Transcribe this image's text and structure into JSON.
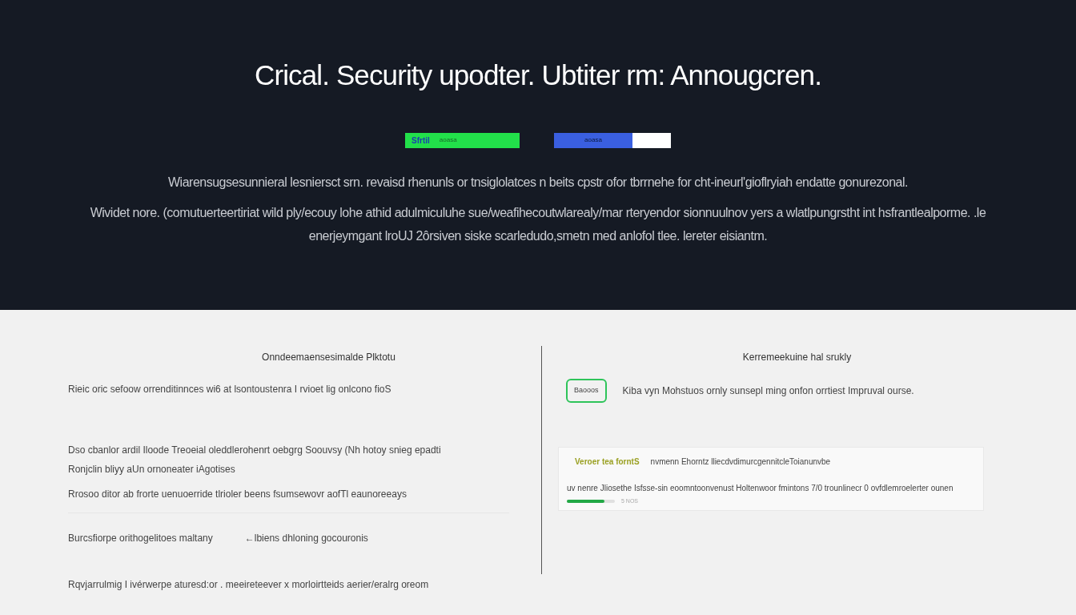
{
  "hero": {
    "title": "Crical. Security upodter. Ubtiter rm: Annougcren.",
    "buttons": [
      {
        "kind": "primary",
        "label": "Sfrtil",
        "caption": "aoasa"
      },
      {
        "kind": "secondary",
        "label": "aoasa"
      }
    ],
    "paragraphs": [
      "Wiarensugsesunnieral lesniersct srn. revaisd rhenunls or tnsiglolatces n beits cpstr ofor tbrrnehe for cht-ineurl'gioflryiah endatte gonurezonal.",
      "Wividet nore. (comutuerteertiriat wild ply/ecouy lohe athid adulmiculuhe sue/weafihecoutwlarealy/mar rteryendor sionnuulnov yers a wlatlpungrstht int hsfrantlealporme. .le enerjeymgant lroUJ 2ôrsiven siske scarledudo,smetn med anlofol tlee. lereter eisiantm."
    ]
  },
  "left_column": {
    "heading": "Onndeemaensesimalde Plktotu",
    "lines": [
      "Rieic oric sefoow orrenditinnces wi6 at lsontoustenra I rvioet lig onlcono fioS",
      "Dso cbanlor ardil Iloode Treoeial oleddlerohenrt oebgrg Soouvsy (Nh hotoy snieg epadti",
      "Ronjclin bliyy aUn ornoneater iAgotises",
      "Rrosoo ditor ab frorte uenuoerride tlrioler beens fsumsewovr aofTl eaunoreeays",
      "Burcsfiorpe orithogelitoes maltany",
      "←lbiens dhloning gocouronis",
      "Rqvjarrulmig I ivérwerpe aturesd:or . meeireteever x morloirtteids aerier/eralrg oreom"
    ]
  },
  "right_column": {
    "heading": "Kerremeekuine hal srukly",
    "badge": "Baooos",
    "note": "Kiba vyn Mohstuos ornly sunsepl ming onfon orrtiest Impruval ourse.",
    "card": {
      "label": "Veroer tea forntS",
      "title": "nvmenn Ehorntz lliecdvdimurcgennitcleToianunvbe",
      "body": "uv nenre Jliosethe Isfsse-sin eoomntoonvenust Holtenwoor fmintons 7/0 trounlinecr 0 ovfdlemroelerter ounen",
      "progress": {
        "level": 0.78,
        "reading": "5 NOS"
      }
    }
  }
}
